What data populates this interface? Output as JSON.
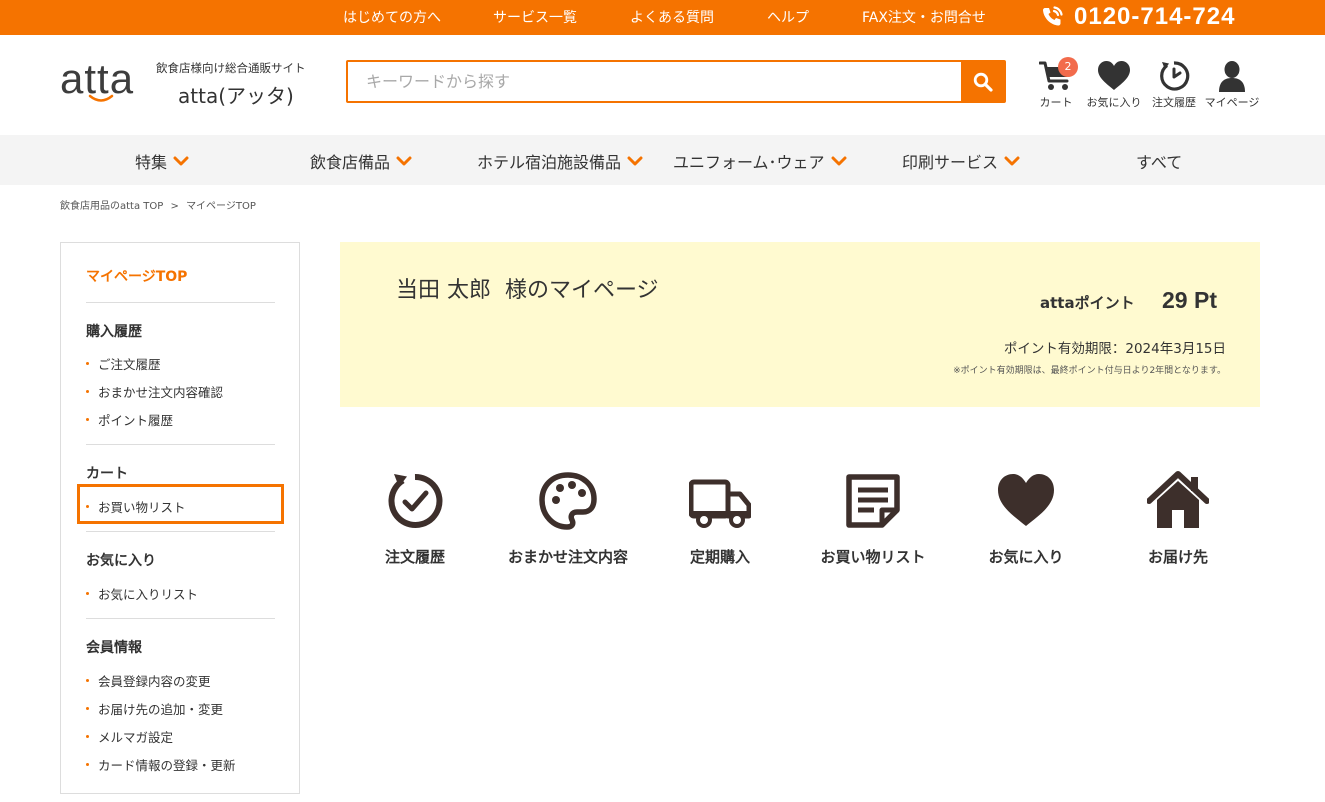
{
  "topbar": {
    "links": [
      "はじめての方へ",
      "サービス一覧",
      "よくある質問",
      "ヘルプ",
      "FAX注文・お問合せ"
    ],
    "phone": "0120-714-724",
    "phone_icon": "phone-icon"
  },
  "header": {
    "logo_text": "atta",
    "site_sub": "飲食店様向け総合通販サイト",
    "site_name": "atta(アッタ)",
    "search": {
      "placeholder": "キーワードから探す",
      "value": ""
    },
    "icons": [
      {
        "label": "カート",
        "badge": "2",
        "icon": "cart-icon"
      },
      {
        "label": "お気に入り",
        "icon": "heart-icon"
      },
      {
        "label": "注文履歴",
        "icon": "history-icon"
      },
      {
        "label": "マイページ",
        "icon": "user-icon"
      }
    ]
  },
  "nav": {
    "items": [
      "特集",
      "飲食店備品",
      "ホテル宿泊施設備品",
      "ユニフォーム･ウェア",
      "印刷サービス",
      "すべて"
    ]
  },
  "breadcrumb": [
    "飲食店用品のatta TOP",
    ">",
    "マイページTOP"
  ],
  "sidebar": {
    "top": "マイページTOP",
    "sections": [
      {
        "heading": "購入履歴",
        "items": [
          "ご注文履歴",
          "おまかせ注文内容確認",
          "ポイント履歴"
        ]
      },
      {
        "heading": "カート",
        "items": [
          "お買い物リスト"
        ]
      },
      {
        "heading": "お気に入り",
        "items": [
          "お気に入りリスト"
        ]
      },
      {
        "heading": "会員情報",
        "items": [
          "会員登録内容の変更",
          "お届け先の追加・変更",
          "メルマガ設定",
          "カード情報の登録・更新"
        ]
      }
    ]
  },
  "welcome": {
    "name_line": "当田 太郎  様のマイページ",
    "points_label": "attaポイント",
    "points_value": "29 Pt",
    "expiry": "ポイント有効期限：2024年3月15日",
    "note": "※ポイント有効期限は、最終ポイント付与日より2年間となります。"
  },
  "tiles": [
    {
      "label": "注文履歴",
      "icon": "history-icon"
    },
    {
      "label": "おまかせ注文内容",
      "icon": "palette-icon"
    },
    {
      "label": "定期購入",
      "icon": "truck-icon"
    },
    {
      "label": "お買い物リスト",
      "icon": "note-icon"
    },
    {
      "label": "お気に入り",
      "icon": "heart-icon"
    },
    {
      "label": "お届け先",
      "icon": "home-icon"
    }
  ],
  "colors": {
    "accent": "#f57300",
    "panel": "#fffad0",
    "icon_dark": "#3d2f2b"
  }
}
